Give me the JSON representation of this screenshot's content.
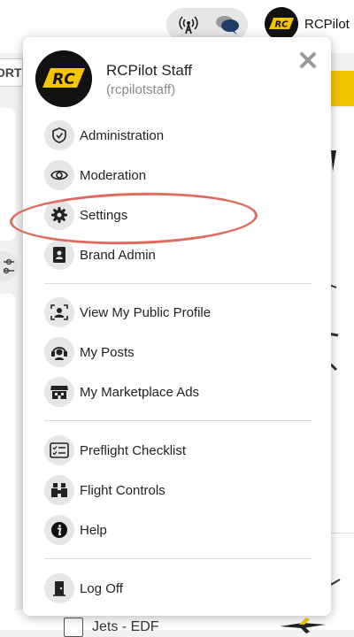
{
  "header": {
    "username": "RCPilot",
    "avatar_text": "RC",
    "partial_tab_text": "ORT"
  },
  "menu": {
    "display_name": "RCPilot Staff",
    "handle": "(rcpilotstaff)",
    "avatar_text": "RC",
    "sections": [
      [
        {
          "label": "Administration",
          "icon": "shield-icon"
        },
        {
          "label": "Moderation",
          "icon": "eye-icon"
        },
        {
          "label": "Settings",
          "icon": "gear-icon"
        },
        {
          "label": "Brand Admin",
          "icon": "contact-book-icon"
        }
      ],
      [
        {
          "label": "View My Public Profile",
          "icon": "profile-icon"
        },
        {
          "label": "My Posts",
          "icon": "headset-user-icon"
        },
        {
          "label": "My Marketplace Ads",
          "icon": "storefront-icon"
        }
      ],
      [
        {
          "label": "Preflight Checklist",
          "icon": "checklist-icon"
        },
        {
          "label": "Flight Controls",
          "icon": "binoculars-icon"
        },
        {
          "label": "Help",
          "icon": "info-icon"
        }
      ],
      [
        {
          "label": "Log Off",
          "icon": "door-exit-icon"
        }
      ]
    ]
  },
  "background": {
    "bottom_row_label": "Jets - EDF"
  },
  "colors": {
    "accent_yellow": "#f5c400",
    "highlight_ring": "#e06a5e"
  }
}
